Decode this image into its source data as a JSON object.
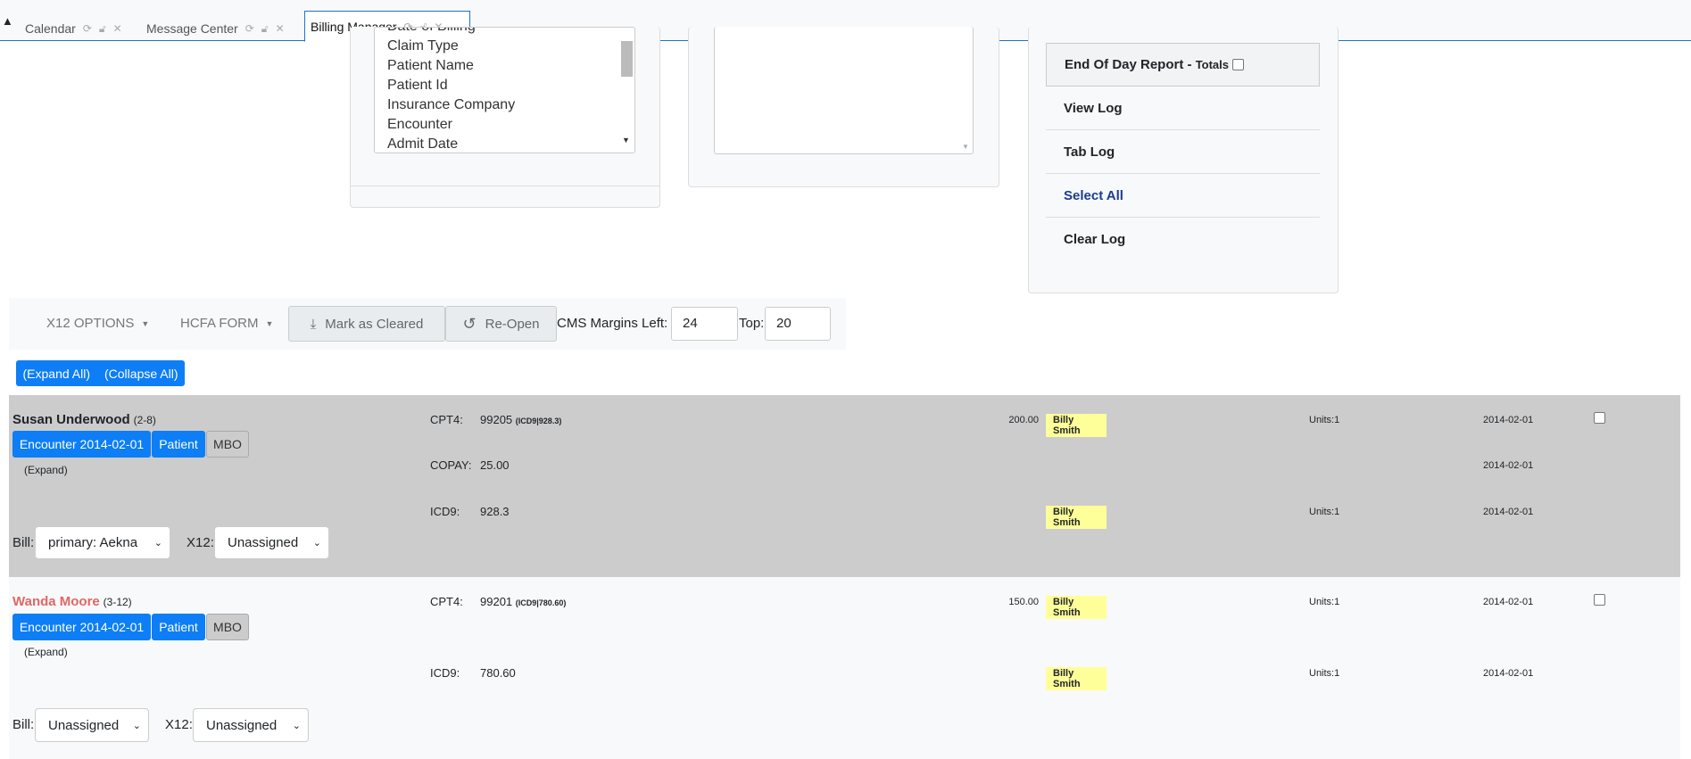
{
  "tabs": [
    {
      "label": "Calendar",
      "active": false
    },
    {
      "label": "Message Center",
      "active": false
    },
    {
      "label": "Billing Manager",
      "active": true
    }
  ],
  "sort_list": {
    "items": [
      "Date of Billing",
      "Claim Type",
      "Patient Name",
      "Patient Id",
      "Insurance Company",
      "Encounter",
      "Admit Date"
    ]
  },
  "report_panel": {
    "end_of_day_label": "End Of Day Report -",
    "totals_label": "Totals",
    "view_log": "View Log",
    "tab_log": "Tab Log",
    "select_all": "Select All",
    "clear_log": "Clear Log"
  },
  "toolbar": {
    "x12_options": "X12 OPTIONS",
    "hcfa_form": "HCFA FORM",
    "mark_cleared": "Mark as Cleared",
    "reopen": "Re-Open",
    "cms_margins_left_label": "CMS Margins Left:",
    "left_value": "24",
    "top_label": "Top:",
    "top_value": "20"
  },
  "expand_all": "(Expand All)",
  "collapse_all": "(Collapse All)",
  "colors": {
    "accent": "#0d7ef5",
    "highlight": "#ffff99",
    "row1_bg": "#cccccc",
    "row2_bg": "#f8f9fa",
    "alert_name": "#e06666"
  },
  "encounters": [
    {
      "name": "Susan Underwood",
      "id": "(2-8)",
      "encounter_btn": "Encounter 2014-02-01",
      "patient_btn": "Patient",
      "mbo_btn": "MBO",
      "expand": "(Expand)",
      "bill_label": "Bill:",
      "bill_value": "primary: Aekna",
      "x12_label": "X12:",
      "x12_value": "Unassigned",
      "lines": [
        {
          "code_label": "CPT4:",
          "code": "99205",
          "code_extra": "(ICD9|928.3)",
          "amount": "200.00",
          "provider": "Billy Smith",
          "units": "Units:1",
          "date": "2014-02-01",
          "checkbox": true
        },
        {
          "code_label": "COPAY:",
          "code": "25.00",
          "code_extra": "",
          "amount": "",
          "provider": "",
          "units": "",
          "date": "2014-02-01",
          "checkbox": false
        },
        {
          "code_label": "ICD9:",
          "code": "928.3",
          "code_extra": "",
          "amount": "",
          "provider": "Billy Smith",
          "units": "Units:1",
          "date": "2014-02-01",
          "checkbox": false
        }
      ]
    },
    {
      "name": "Wanda Moore",
      "id": "(3-12)",
      "encounter_btn": "Encounter 2014-02-01",
      "patient_btn": "Patient",
      "mbo_btn": "MBO",
      "expand": "(Expand)",
      "bill_label": "Bill:",
      "bill_value": "Unassigned",
      "x12_label": "X12:",
      "x12_value": "Unassigned",
      "lines": [
        {
          "code_label": "CPT4:",
          "code": "99201",
          "code_extra": "(ICD9|780.60)",
          "amount": "150.00",
          "provider": "Billy Smith",
          "units": "Units:1",
          "date": "2014-02-01",
          "checkbox": true
        },
        {
          "code_label": "ICD9:",
          "code": "780.60",
          "code_extra": "",
          "amount": "",
          "provider": "Billy Smith",
          "units": "Units:1",
          "date": "2014-02-01",
          "checkbox": false
        }
      ]
    }
  ]
}
